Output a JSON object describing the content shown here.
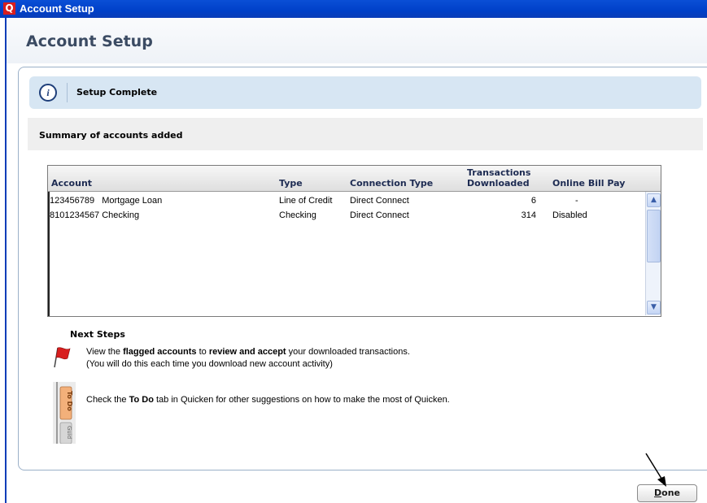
{
  "window": {
    "title": "Account Setup",
    "app_icon_letter": "Q"
  },
  "page": {
    "title": "Account Setup"
  },
  "info": {
    "icon": "info-icon",
    "message": "Setup Complete"
  },
  "summary": {
    "heading": "Summary of accounts added"
  },
  "table": {
    "headers": {
      "account": "Account",
      "type": "Type",
      "connection_type": "Connection Type",
      "transactions_line1": "Transactions",
      "transactions_line2": "Downloaded",
      "online_bill_pay": "Online Bill Pay"
    },
    "rows": [
      {
        "account": "123456789   Mortgage Loan",
        "type": "Line of Credit",
        "connection_type": "Direct Connect",
        "transactions": "6",
        "online_bill_pay": "-"
      },
      {
        "account": "8101234567 Checking",
        "type": "Checking",
        "connection_type": "Direct Connect",
        "transactions": "314",
        "online_bill_pay": "Disabled"
      }
    ]
  },
  "next_steps": {
    "title": "Next Steps",
    "step1": {
      "icon": "flag-icon",
      "pre": "View the ",
      "bold1": "flagged accounts",
      "mid": " to ",
      "bold2": "review and accept",
      "post": " your downloaded transactions.",
      "line2": "(You will do this each time you download new account activity)"
    },
    "step2": {
      "icon": "todo-tab-icon",
      "tab1_label": "To Do",
      "tab2_label": "Guid",
      "pre": "Check the ",
      "bold": "To Do",
      "post": " tab in Quicken for other suggestions on how to make the most of Quicken."
    }
  },
  "footer": {
    "done_label_underlined": "D",
    "done_label_rest": "one"
  },
  "colors": {
    "titlebar": "#0040c8",
    "info_bar": "#d7e6f3",
    "flag": "#d81e1e",
    "todo_tab": "#f3b07a"
  }
}
